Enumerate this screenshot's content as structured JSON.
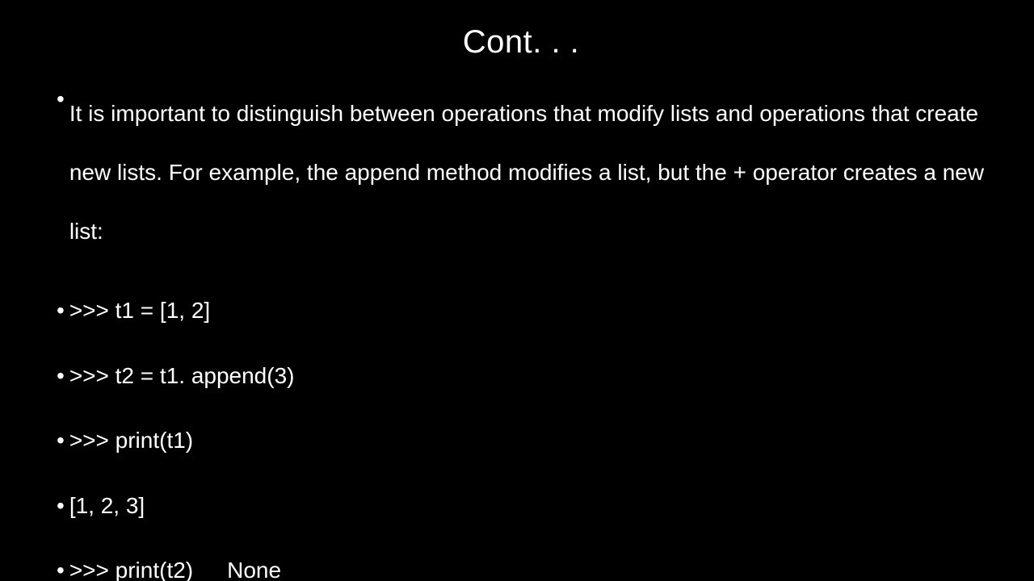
{
  "title": "Cont. . .",
  "bullets": [
    "It is important to distinguish between operations that modify lists and operations that create new lists. For example, the append method modifies a list, but the + operator creates a new list:",
    ">>> t1 = [1, 2]",
    ">>> t2 = t1. append(3)",
    ">>> print(t1)",
    "[1, 2, 3]",
    ">>> print(t2)  None"
  ]
}
